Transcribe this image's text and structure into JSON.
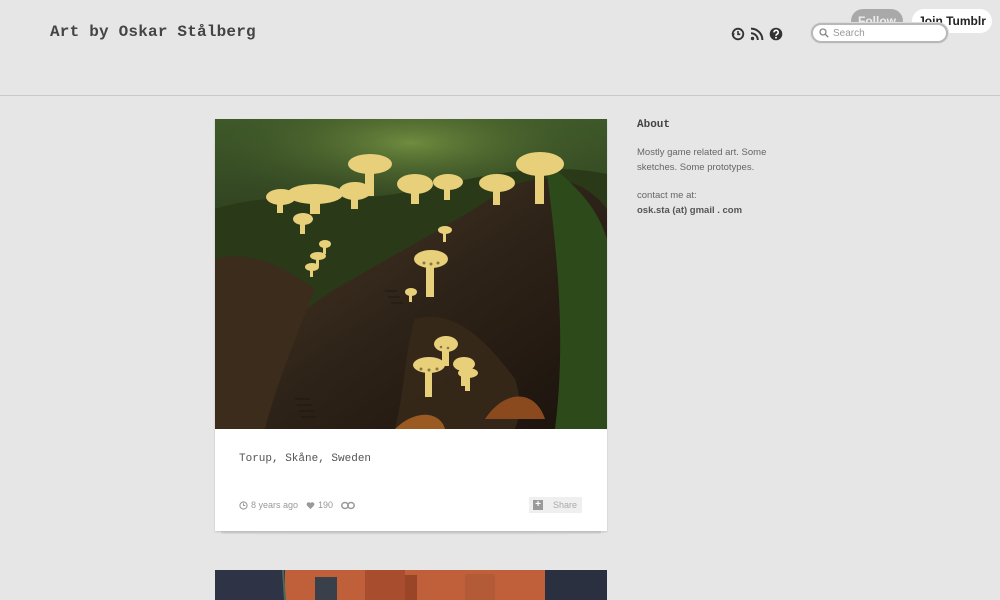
{
  "header": {
    "title": "Art by Oskar Stålberg",
    "icons": [
      "history-icon",
      "rss-icon",
      "help-icon"
    ],
    "follow_label": "Follow",
    "join_label": "Join Tumblr",
    "search_placeholder": "Search"
  },
  "post": {
    "caption": "Torup, Skåne, Sweden",
    "time": "8 years ago",
    "likes": "190",
    "share_label": "Share"
  },
  "about": {
    "title": "About",
    "text": "Mostly game related art. Some sketches. Some prototypes.",
    "contact_label": "contact me at:",
    "contact_email": "osk.sta (at) gmail . com"
  },
  "colors": {
    "background": "#e6e6e6",
    "follow_button": "#a9a9a9",
    "card": "#ffffff"
  }
}
